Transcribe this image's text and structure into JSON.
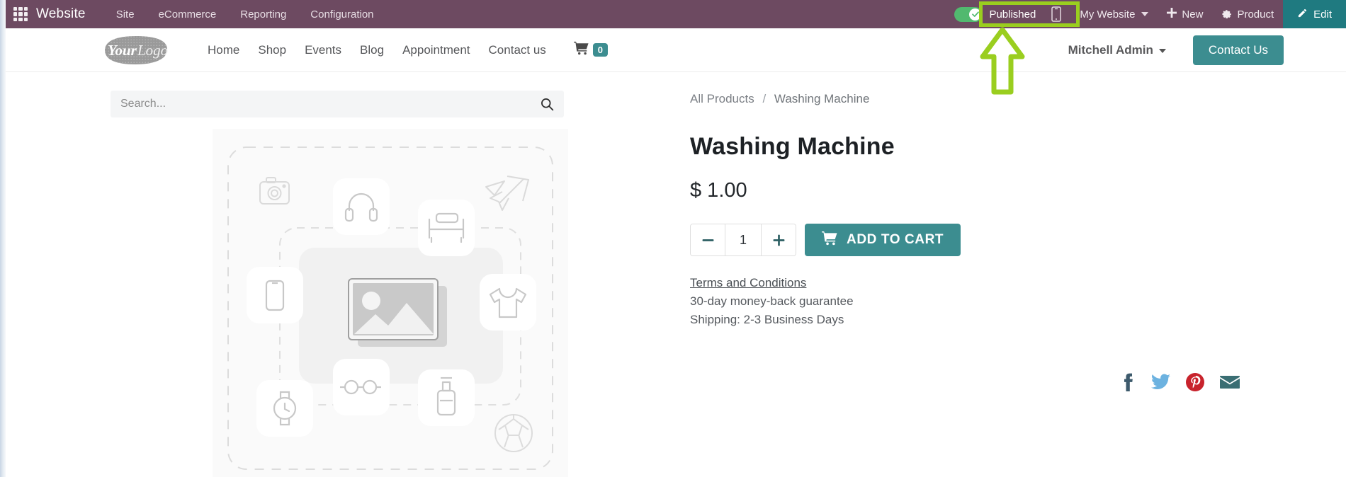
{
  "system_bar": {
    "apps_icon": "apps-grid-icon",
    "app_name": "Website",
    "menus": [
      "Site",
      "eCommerce",
      "Reporting",
      "Configuration"
    ],
    "publish": {
      "label": "Published",
      "state": "on",
      "toggle_color": "#51b96f",
      "check_icon": "check-circle-icon"
    },
    "mobile_preview_icon": "mobile-phone-icon",
    "website_selector": {
      "label": "My Website",
      "caret": "chevron-down-icon"
    },
    "new_button": {
      "label": "New",
      "icon": "plus-icon"
    },
    "product_button": {
      "label": "Product",
      "icon": "gear-icon"
    },
    "edit_button": {
      "label": "Edit",
      "icon": "pencil-icon",
      "color": "#1f7a80"
    },
    "background_color": "#6d4a61"
  },
  "site_header": {
    "logo_text_1": "Your",
    "logo_text_2": "Logo",
    "nav": [
      "Home",
      "Shop",
      "Events",
      "Blog",
      "Appointment",
      "Contact us"
    ],
    "cart": {
      "icon": "shopping-cart-icon",
      "count": "0",
      "badge_color": "#3c8d90"
    },
    "user": {
      "name": "Mitchell Admin",
      "caret": "chevron-down-icon"
    },
    "cta_button": {
      "label": "Contact Us",
      "color": "#3c8d90"
    }
  },
  "search": {
    "placeholder": "Search...",
    "value": "",
    "icon": "magnifier-icon"
  },
  "product_image": {
    "alt": "product-image-placeholder",
    "icons": [
      "camera-icon",
      "headphones-icon",
      "bed-icon",
      "airplane-icon",
      "smartphone-icon",
      "image-icon",
      "tshirt-icon",
      "watch-icon",
      "glasses-icon",
      "bottle-icon",
      "football-icon"
    ]
  },
  "breadcrumb": {
    "parent": "All Products",
    "separator": "/",
    "current": "Washing Machine"
  },
  "product": {
    "title": "Washing Machine",
    "currency": "$",
    "price": "1.00",
    "price_display": "$ 1.00",
    "quantity": "1",
    "decrement_icon": "minus-icon",
    "increment_icon": "plus-icon",
    "add_to_cart_label": "ADD TO CART",
    "add_to_cart_icon": "shopping-cart-icon",
    "terms_link": "Terms and Conditions",
    "guarantee": "30-day money-back guarantee",
    "shipping": "Shipping: 2-3 Business Days"
  },
  "socials": [
    {
      "name": "facebook-icon",
      "color": "#3d5a6c"
    },
    {
      "name": "twitter-icon",
      "color": "#6cb2e0"
    },
    {
      "name": "pinterest-icon",
      "color": "#c8232c"
    },
    {
      "name": "email-icon",
      "color": "#3a6e73"
    }
  ],
  "annotation": {
    "highlight_color": "#9ace1f",
    "box_target": "published-toggle",
    "arrow_direction": "up"
  }
}
